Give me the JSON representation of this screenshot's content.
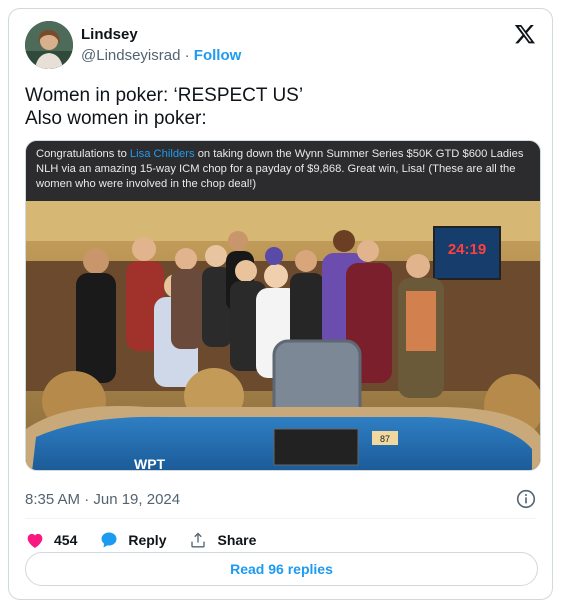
{
  "author": {
    "name": "Lindsey",
    "handle": "@Lindseyisrad",
    "separator": "·",
    "follow_label": "Follow"
  },
  "tweet": {
    "line1": "Women in poker: ‘RESPECT US’",
    "line2": "Also women in poker:"
  },
  "media": {
    "caption_pre": "Congratulations to ",
    "caption_link": "Lisa Childers",
    "caption_post": " on taking down the Wynn Summer Series $50K GTD $600 Ladies NLH via an amazing 15-way ICM chop for a payday of $9,868. Great win, Lisa! (These are all the women who were involved in the chop deal!)",
    "clock_text": "24:19",
    "table_number": "87",
    "table_logo": "WPT"
  },
  "meta": {
    "timestamp": "8:35 AM · Jun 19, 2024"
  },
  "actions": {
    "like_count": "454",
    "reply_label": "Reply",
    "share_label": "Share"
  },
  "read_replies_label": "Read 96 replies",
  "colors": {
    "accent": "#1d9bf0",
    "like": "#f91880",
    "text": "#0f1419",
    "muted": "#536471"
  },
  "icons": [
    "x-logo-icon",
    "info-icon",
    "heart-icon",
    "reply-bubble-icon",
    "share-icon"
  ]
}
